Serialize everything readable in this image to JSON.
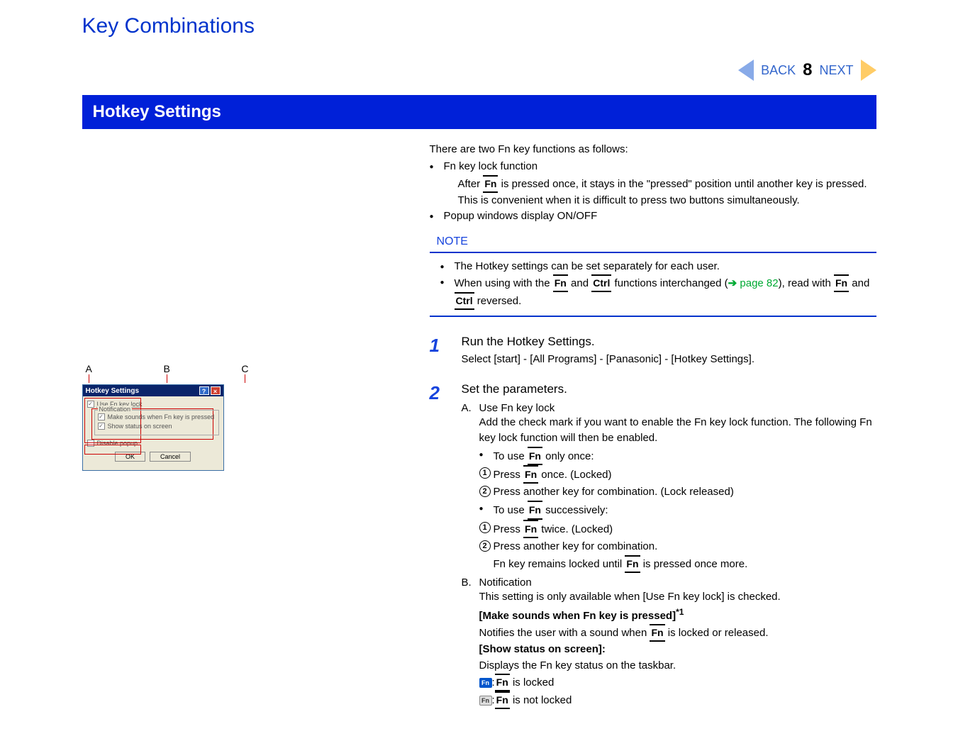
{
  "page_title": "Key Combinations",
  "nav": {
    "back": "BACK",
    "page": "8",
    "next": "NEXT"
  },
  "section_title": "Hotkey Settings",
  "intro": "There are two Fn key functions as follows:",
  "intro_bullets": {
    "b1": "Fn key lock function",
    "b1_sub1": "After ",
    "b1_sub1b": " is pressed once, it stays in the \"pressed\" position until another key is pressed.",
    "b1_sub2": "This is convenient when it is difficult to press two buttons simultaneously.",
    "b2": "Popup windows display ON/OFF"
  },
  "note_label": "NOTE",
  "note": {
    "n1": "The Hotkey settings can be set separately for each user.",
    "n2a": "When using with the ",
    "n2b": " and ",
    "n2c": " functions interchanged (",
    "n2_link": "page 82",
    "n2d": "), read with ",
    "n2e": " and ",
    "n2f": " reversed."
  },
  "keys": {
    "fn": "Fn",
    "ctrl": "Ctrl"
  },
  "steps": {
    "s1": {
      "num": "1",
      "title": "Run the Hotkey Settings.",
      "desc": "Select [start] - [All Programs] - [Panasonic] - [Hotkey Settings]."
    },
    "s2": {
      "num": "2",
      "title": "Set the parameters.",
      "A": {
        "letter": "A.",
        "title": "Use Fn key lock",
        "desc": "Add the check mark if you want to enable the Fn key lock function. The following Fn key lock function will then be enabled.",
        "once_label_a": "To use ",
        "once_label_b": " only once:",
        "once_1a": "Press ",
        "once_1b": " once. (Locked)",
        "once_2": "Press another key for combination. (Lock released)",
        "succ_label_a": "To use ",
        "succ_label_b": " successively:",
        "succ_1a": "Press ",
        "succ_1b": " twice. (Locked)",
        "succ_2": "Press another key for combination.",
        "succ_2_sub_a": "Fn key remains locked until ",
        "succ_2_sub_b": " is pressed once more."
      },
      "B": {
        "letter": "B.",
        "title": "Notification",
        "desc": "This setting is only available when [Use Fn key lock] is checked.",
        "make_sounds": "[Make sounds when Fn key is pressed]",
        "footnote": "*1",
        "notifies_a": "Notifies the user with a sound when ",
        "notifies_b": " is locked or released.",
        "show_status": "[Show status on screen]:",
        "displays": "Displays the Fn key status on the taskbar.",
        "locked_a": ":",
        "locked_b": " is locked",
        "unlocked_a": ":",
        "unlocked_b": " is not locked"
      }
    }
  },
  "dialog": {
    "labels": {
      "a": "A",
      "b": "B",
      "c": "C"
    },
    "title": "Hotkey Settings",
    "help": "?",
    "close": "×",
    "use_fn": "Use Fn key lock",
    "notification": "Notification",
    "make_sounds": "Make sounds when Fn key is pressed",
    "show_status": "Show status on screen",
    "disable_popup": "Disable popup",
    "ok": "OK",
    "cancel": "Cancel"
  },
  "icon_fn": "Fn"
}
